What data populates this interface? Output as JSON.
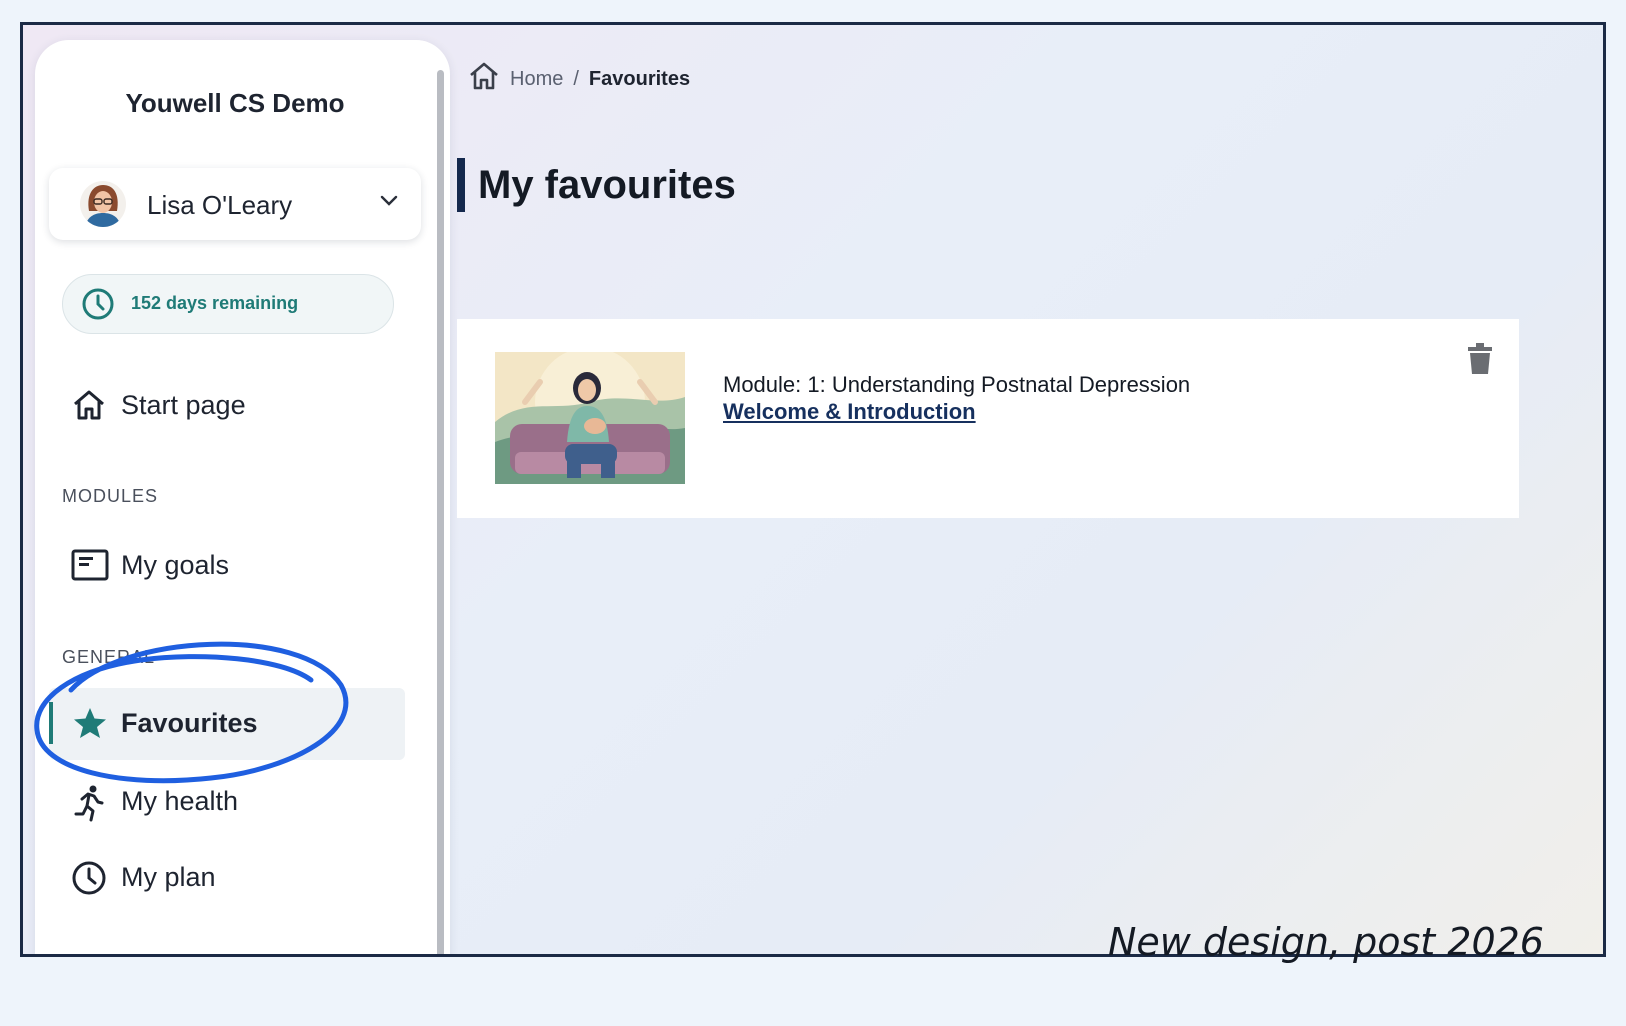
{
  "sidebar": {
    "app_title": "Youwell CS Demo",
    "user": {
      "name": "Lisa O'Leary",
      "avatar_icon": "user-avatar"
    },
    "days_remaining": "152 days remaining",
    "start_page": {
      "label": "Start page",
      "icon": "home-icon"
    },
    "sections": [
      {
        "label": "MODULES",
        "items": [
          {
            "label": "My goals",
            "icon": "goals-icon"
          }
        ]
      },
      {
        "label": "GENERAL",
        "items": [
          {
            "label": "Favourites",
            "icon": "star-icon",
            "active": true
          },
          {
            "label": "My health",
            "icon": "running-icon"
          },
          {
            "label": "My plan",
            "icon": "clock-icon"
          }
        ]
      }
    ]
  },
  "breadcrumb": {
    "home": "Home",
    "separator": "/",
    "current": "Favourites"
  },
  "page_title": "My favourites",
  "favourites": [
    {
      "module": "Module: 1: Understanding Postnatal Depression",
      "lesson": "Welcome & Introduction"
    }
  ],
  "caption": "New design, post 2026",
  "colors": {
    "accent": "#1f7b77",
    "title_bar": "#14284d",
    "link": "#16305e",
    "annotation": "#1f5fe0"
  }
}
